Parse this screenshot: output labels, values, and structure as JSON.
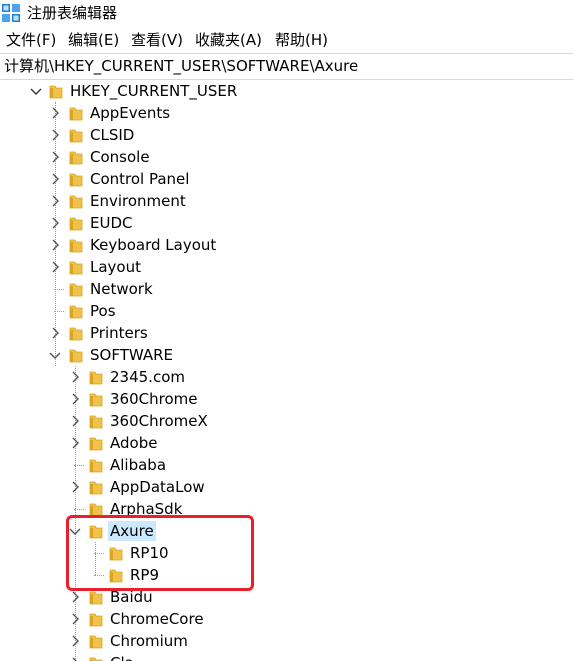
{
  "window": {
    "title": "注册表编辑器"
  },
  "menu": [
    {
      "label": "文件(F)"
    },
    {
      "label": "编辑(E)"
    },
    {
      "label": "查看(V)"
    },
    {
      "label": "收藏夹(A)"
    },
    {
      "label": "帮助(H)"
    }
  ],
  "address": {
    "path": "计算机\\HKEY_CURRENT_USER\\SOFTWARE\\Axure"
  },
  "tree": {
    "root": {
      "label": "HKEY_CURRENT_USER",
      "expanded": true
    },
    "hkcu_children": [
      {
        "label": "AppEvents",
        "expandable": true
      },
      {
        "label": "CLSID",
        "expandable": true
      },
      {
        "label": "Console",
        "expandable": true
      },
      {
        "label": "Control Panel",
        "expandable": true
      },
      {
        "label": "Environment",
        "expandable": true
      },
      {
        "label": "EUDC",
        "expandable": true
      },
      {
        "label": "Keyboard Layout",
        "expandable": true
      },
      {
        "label": "Layout",
        "expandable": true
      },
      {
        "label": "Network",
        "expandable": false
      },
      {
        "label": "Pos",
        "expandable": false
      },
      {
        "label": "Printers",
        "expandable": true
      },
      {
        "label": "SOFTWARE",
        "expandable": true,
        "expanded": true
      }
    ],
    "software_children": [
      {
        "label": "2345.com",
        "expandable": true
      },
      {
        "label": "360Chrome",
        "expandable": true
      },
      {
        "label": "360ChromeX",
        "expandable": true
      },
      {
        "label": "Adobe",
        "expandable": true
      },
      {
        "label": "Alibaba",
        "expandable": false
      },
      {
        "label": "AppDataLow",
        "expandable": true
      },
      {
        "label": "ArphaSdk",
        "expandable": false
      },
      {
        "label": "Axure",
        "expandable": true,
        "expanded": true,
        "selected": true
      },
      {
        "label": "Baidu",
        "expandable": true
      },
      {
        "label": "ChromeCore",
        "expandable": true
      },
      {
        "label": "Chromium",
        "expandable": true
      },
      {
        "label": "Cla",
        "expandable": true
      }
    ],
    "axure_children": [
      {
        "label": "RP10"
      },
      {
        "label": "RP9"
      }
    ]
  },
  "colors": {
    "folder": "#f0c24b",
    "folder_dark": "#d9a520",
    "selection": "#cce8ff",
    "annotation_box": "#e8202a",
    "app_icon": "#1e7fd6"
  },
  "icons": {
    "app": "registry-editor-icon",
    "folder": "folder-icon",
    "chevron_right": "chevron-right-icon",
    "chevron_down": "chevron-down-icon"
  }
}
